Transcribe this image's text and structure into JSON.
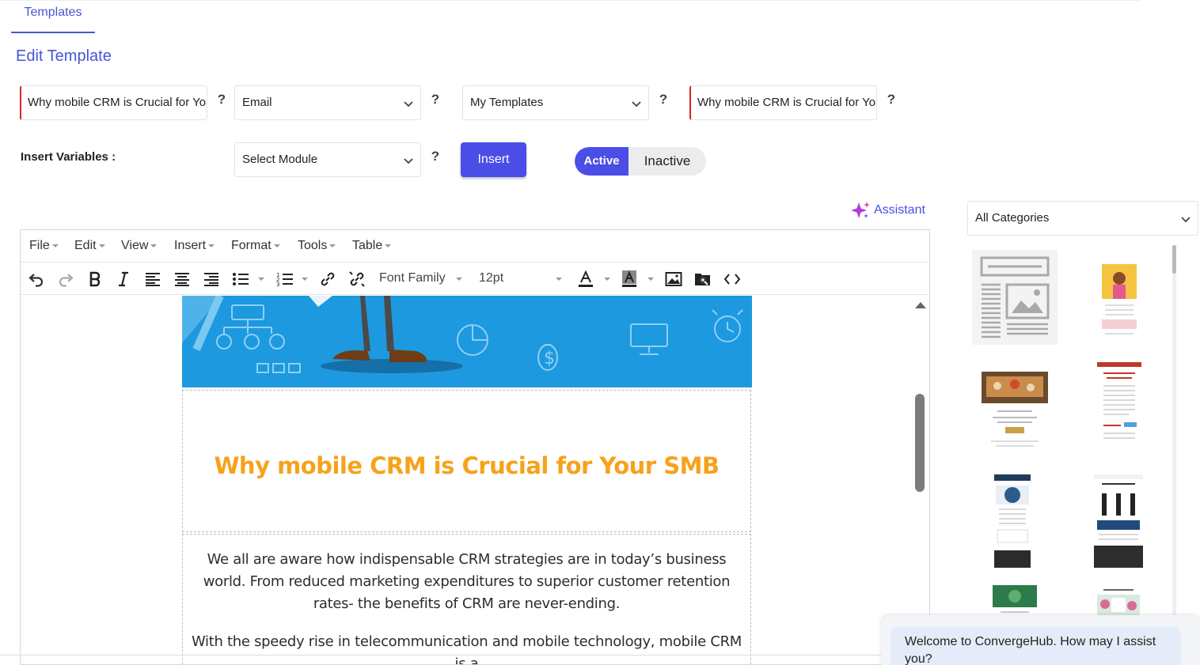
{
  "tabs": [
    {
      "label": "Templates"
    }
  ],
  "page_title": "Edit Template",
  "fields": {
    "template_name": "Why mobile CRM is Crucial for Your SMB",
    "type_select": "Email",
    "folder_select": "My Templates",
    "subject": "Why mobile CRM is Crucial for Your SMB",
    "help_glyph": "?"
  },
  "insert_variables": {
    "label": "Insert Variables :",
    "module_select": "Select Module",
    "insert_button": "Insert"
  },
  "status_toggle": {
    "active": "Active",
    "inactive": "Inactive",
    "selected": "Active"
  },
  "assistant_label": "Assistant",
  "editor": {
    "menus": [
      {
        "label": "File"
      },
      {
        "label": "Edit"
      },
      {
        "label": "View"
      },
      {
        "label": "Insert"
      },
      {
        "label": "Format"
      },
      {
        "label": "Tools"
      },
      {
        "label": "Table"
      }
    ],
    "toolbar": {
      "font_family": "Font Family",
      "font_size": "12pt"
    },
    "content": {
      "headline": "Why mobile CRM is Crucial for Your SMB",
      "paragraph_1": "We all are aware how indispensable CRM strategies are in today’s business world. From reduced marketing expenditures to superior customer retention rates- the benefits of CRM are never-ending.",
      "paragraph_2": "With the speedy rise in telecommunication and mobile technology, mobile CRM is a"
    }
  },
  "gallery": {
    "category_select": "All Categories"
  },
  "chat": {
    "message": "Welcome to ConvergeHub. How may I assist you?"
  },
  "colors": {
    "accent": "#4b4ee6",
    "headline": "#f6a21b",
    "hero_bg": "#1d99df",
    "required": "#d8232a"
  }
}
